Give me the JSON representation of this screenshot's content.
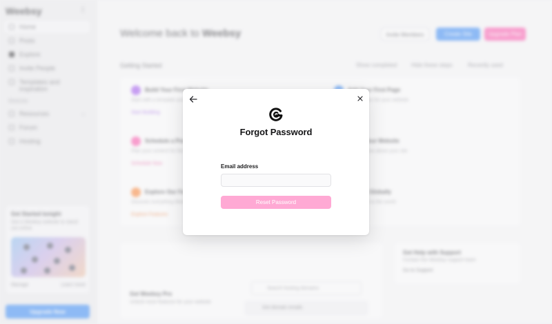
{
  "sidebar": {
    "logo": "Weebsy",
    "items": [
      {
        "label": "Home"
      },
      {
        "label": "Posts"
      },
      {
        "label": "Explore"
      },
      {
        "label": "Invite People"
      },
      {
        "label": "Templates and inspiration"
      }
    ],
    "section_label": "Website",
    "section_items": [
      {
        "label": "Resources"
      },
      {
        "label": "Forum"
      },
      {
        "label": "Hosting"
      }
    ],
    "promo": {
      "title": "Get Started tonight",
      "subtitle": "Get a Weebsy website to stand out online",
      "link_left": "Manage",
      "link_right": "Learn more"
    },
    "upgrade_button": "Upgrade Now"
  },
  "header": {
    "welcome_prefix": "Welcome back to ",
    "welcome_brand": "Weebsy",
    "invite_button": "Invite Members",
    "new_button": "Create Site",
    "pink_button": "Upgrade Plan"
  },
  "dashboard": {
    "section_title": "Getting Started",
    "links": [
      "Show completed",
      "Hide these steps",
      "Recently used"
    ],
    "tiles": [
      {
        "title": "Build Your First Website",
        "desc": "Start with a template and customize it",
        "link": "Start Building",
        "color": "#a65cf2",
        "link_color": "#9b5de5"
      },
      {
        "title": "Add Your First Page",
        "desc": "Create new pages for your website",
        "link": "",
        "color": "#3f8ff7",
        "link_color": "#3f8ff7"
      },
      {
        "title": "Schedule a Post",
        "desc": "Plan your content for the week",
        "link": "Schedule Now",
        "color": "#ff5bb0",
        "link_color": "#e8559d"
      },
      {
        "title": "Share Your Website",
        "desc": "Let everyone know about your site",
        "link": "",
        "color": "#3f8ff7",
        "link_color": "#3f8ff7"
      },
      {
        "title": "Explore Our Features",
        "desc": "Discover everything Weebsy offers",
        "link": "Explore Features",
        "color": "#ff8a3c",
        "link_color": "#f07a33"
      },
      {
        "title": "Go Live Globally",
        "desc": "Publish your site to the world",
        "link": "",
        "color": "#3f8ff7",
        "link_color": "#3f8ff7"
      }
    ],
    "lower": {
      "title": "Get Weebsy Pro",
      "desc": "Unlock more features for your website",
      "mini_search": "Search hosting domains",
      "mini_item": "Get domain emails"
    },
    "side_card": {
      "title": "Get Help with Support",
      "desc": "Contact the Weebsy support team",
      "link": "Go to Support"
    }
  },
  "modal": {
    "title": "Forgot Password",
    "email_label": "Email address",
    "email_value": "",
    "email_placeholder": "",
    "reset_button": "Reset Password",
    "colors": {
      "accent": "#ffa9d4",
      "text": "#141416"
    }
  }
}
